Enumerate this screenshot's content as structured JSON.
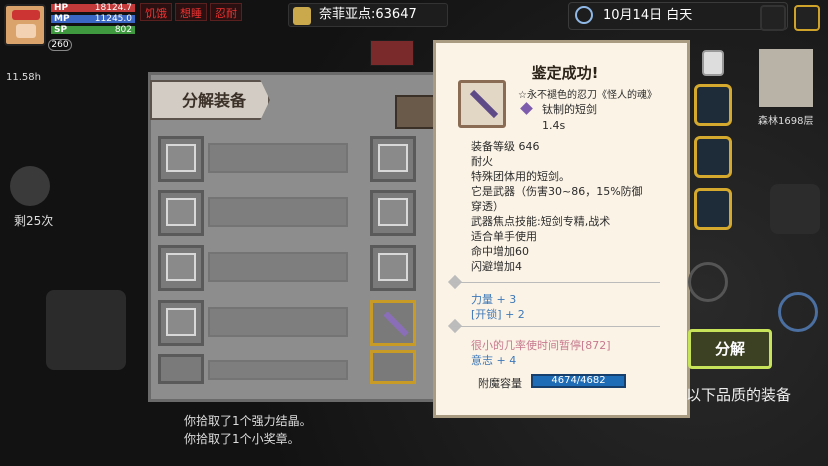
{
  "hud": {
    "hp_label": "HP",
    "hp_value": "18124.7",
    "mp_label": "MP",
    "mp_value": "11245.0",
    "sp_label": "SP",
    "sp_value": "802",
    "level": "260",
    "timer": "11.58h",
    "status_hungry": "饥饿",
    "status_sleepy": "想睡",
    "status_forget": "忍耐"
  },
  "gold": {
    "label": "奈菲亚点:63647"
  },
  "date": {
    "text": "10月14日  白天"
  },
  "panel": {
    "title": "分解装备"
  },
  "tooltip": {
    "title": "鉴定成功!",
    "subtitle": "☆永不褪色的忍刀《怪人的魂》",
    "item_name": "钛制的短剑",
    "weight": "1.4s",
    "lines": [
      "装备等级 646",
      "耐火",
      "特殊团体用的短剑。",
      "它是武器（伤害30~86，15%防御",
      "穿透）",
      "武器焦点技能:短剑专精,战术",
      "适合单手使用",
      "命中增加60",
      "闪避增加4"
    ],
    "blue_lines": [
      "力量 + 3",
      "[开锁] + 2"
    ],
    "pink_line": "很小的几率使时间暂停[872]",
    "blue_line2": "意志 + 4",
    "enchant_label": "附魔容量",
    "enchant_value": "4674/4682"
  },
  "side": {
    "decompose_button": "分解",
    "quality_text": "以下品质的装备",
    "floor": "森林1698层",
    "remaining": "剩25次"
  },
  "log": {
    "line1": "你拾取了1个强力结晶。",
    "line2": "你拾取了1个小奖章。"
  }
}
